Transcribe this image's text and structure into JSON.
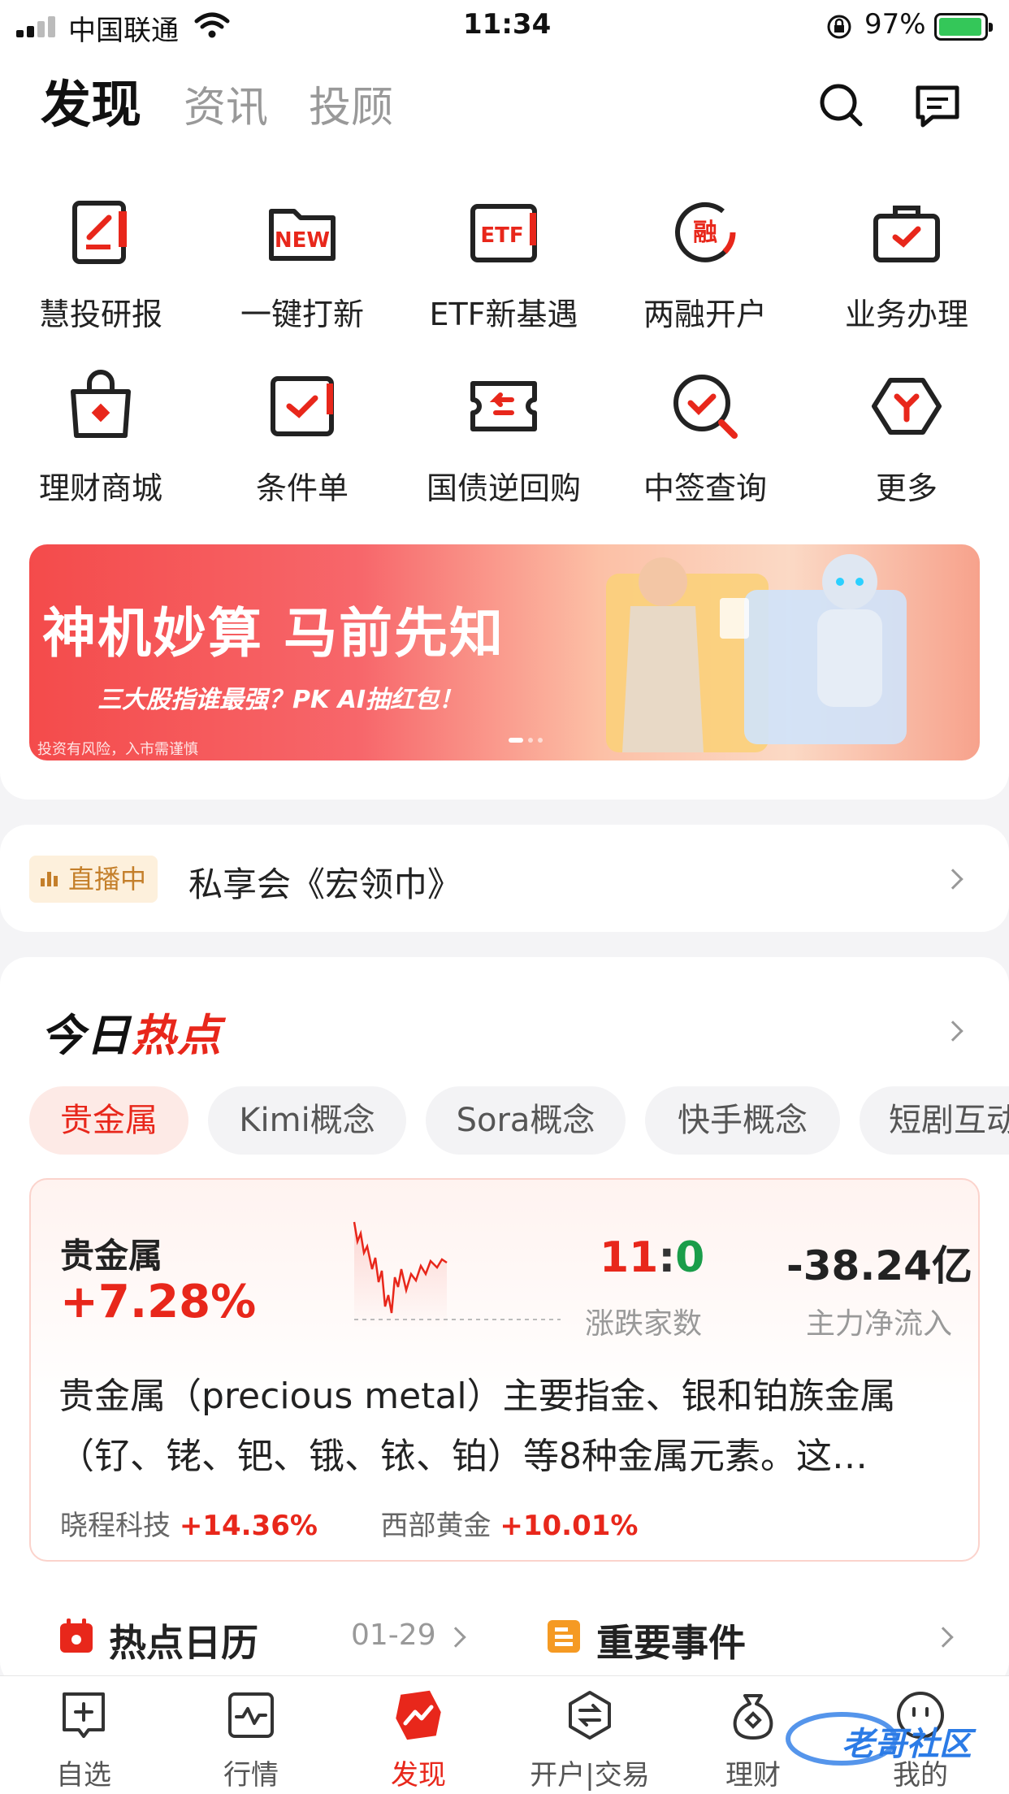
{
  "status_bar": {
    "carrier": "中国联通",
    "time": "11:34",
    "battery": "97%"
  },
  "header": {
    "tabs": [
      {
        "label": "发现",
        "active": true
      },
      {
        "label": "资讯",
        "active": false
      },
      {
        "label": "投顾",
        "active": false
      }
    ]
  },
  "quick_grid": [
    {
      "label": "慧投研报",
      "icon": "report-icon"
    },
    {
      "label": "一键打新",
      "icon": "new-folder-icon"
    },
    {
      "label": "ETF新基遇",
      "icon": "etf-icon"
    },
    {
      "label": "两融开户",
      "icon": "margin-icon"
    },
    {
      "label": "业务办理",
      "icon": "business-bag-icon"
    },
    {
      "label": "理财商城",
      "icon": "shopping-bag-icon"
    },
    {
      "label": "条件单",
      "icon": "condition-order-icon"
    },
    {
      "label": "国债逆回购",
      "icon": "bond-repo-icon"
    },
    {
      "label": "中签查询",
      "icon": "lottery-check-icon"
    },
    {
      "label": "更多",
      "icon": "more-icon"
    }
  ],
  "banner": {
    "title": "神机妙算 马前先知",
    "subtitle": "三大股指谁最强？PK AI抽红包！",
    "footnote": "投资有风险，入市需谨慎"
  },
  "live": {
    "badge": "直播中",
    "title": "私享会《宏领巾》"
  },
  "hot": {
    "title_a": "今日",
    "title_b": "热点",
    "chips": [
      "贵金属",
      "Kimi概念",
      "Sora概念",
      "快手概念",
      "短剧互动"
    ],
    "card": {
      "name": "贵金属",
      "change": "+7.28%",
      "ratio_up": "11",
      "ratio_sep": ":",
      "ratio_down": "0",
      "ratio_label": "涨跌家数",
      "net_flow": "-38.24亿",
      "net_flow_label": "主力净流入",
      "description": "贵金属（precious metal）主要指金、银和铂族金属（钌、铑、钯、锇、铱、铂）等8种金属元素。这…",
      "stocks": [
        {
          "name": "晓程科技",
          "change": "+14.36%"
        },
        {
          "name": "西部黄金",
          "change": "+10.01%"
        }
      ]
    },
    "calendar": {
      "title": "热点日历",
      "date": "01-29"
    },
    "events": {
      "title": "重要事件"
    }
  },
  "bottom_nav": [
    {
      "label": "自选",
      "active": false
    },
    {
      "label": "行情",
      "active": false
    },
    {
      "label": "发现",
      "active": true
    },
    {
      "label": "开户|交易",
      "active": false
    },
    {
      "label": "理财",
      "active": false
    },
    {
      "label": "我的",
      "active": false
    }
  ],
  "watermark": "老哥社区",
  "colors": {
    "accent": "#e8271b",
    "green": "#1a9d4a",
    "live_gold": "#c47f2a"
  }
}
